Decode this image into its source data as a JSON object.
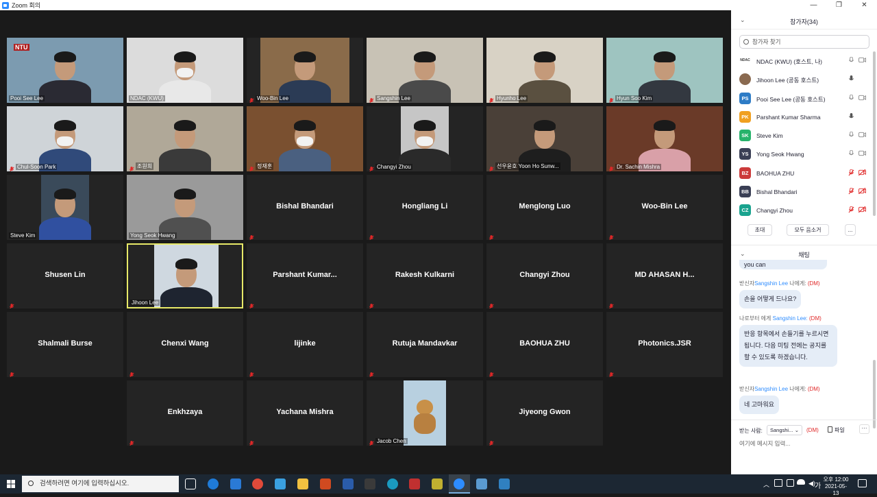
{
  "window": {
    "title": "Zoom 회의",
    "buttons": [
      "—",
      "❐",
      "✕"
    ]
  },
  "tiles": [
    {
      "label": "Pooi See Lee",
      "muted": false,
      "video": true
    },
    {
      "label": "NDAC (KWU)",
      "muted": false,
      "video": true
    },
    {
      "label": "Woo-Bin Lee",
      "muted": true,
      "video": true
    },
    {
      "label": "Sangshin Lee",
      "muted": true,
      "video": true
    },
    {
      "label": "Hyunho Lee",
      "muted": true,
      "video": true
    },
    {
      "label": "Hyun Soo Kim",
      "muted": true,
      "video": true
    },
    {
      "label": "Chul-Soon Park",
      "muted": true,
      "video": true
    },
    {
      "label": "조원희",
      "muted": true,
      "video": true
    },
    {
      "label": "정재훈",
      "muted": true,
      "video": true
    },
    {
      "label": "Changyi Zhou",
      "muted": true,
      "video": true
    },
    {
      "label": "선우윤호 Yoon Ho Sunw...",
      "muted": true,
      "video": true
    },
    {
      "label": "Dr. Sachin Mishra",
      "muted": true,
      "video": true
    },
    {
      "label": "Steve Kim",
      "muted": false,
      "video": true
    },
    {
      "label": "Yong Seok Hwang",
      "muted": false,
      "video": true
    },
    {
      "name": "Bishal Bhandari",
      "muted": true,
      "video": false
    },
    {
      "name": "Hongliang Li",
      "muted": true,
      "video": false
    },
    {
      "name": "Menglong Luo",
      "muted": true,
      "video": false
    },
    {
      "name": "Woo-Bin Lee",
      "muted": true,
      "video": false
    },
    {
      "name": "Shusen Lin",
      "muted": true,
      "video": false
    },
    {
      "label": "Jihoon Lee",
      "muted": false,
      "video": true,
      "active": true
    },
    {
      "name": "Parshant  Kumar...",
      "muted": true,
      "video": false
    },
    {
      "name": "Rakesh Kulkarni",
      "muted": true,
      "video": false
    },
    {
      "name": "Changyi Zhou",
      "muted": true,
      "video": false
    },
    {
      "name": "MD  AHASAN  H...",
      "muted": true,
      "video": false
    },
    {
      "name": "Shalmali Burse",
      "muted": true,
      "video": false
    },
    {
      "name": "Chenxi Wang",
      "muted": true,
      "video": false
    },
    {
      "name": "lijinke",
      "muted": true,
      "video": false
    },
    {
      "name": "Rutuja Mandavkar",
      "muted": true,
      "video": false
    },
    {
      "name": "BAOHUA ZHU",
      "muted": true,
      "video": false
    },
    {
      "name": "Photonics.JSR",
      "muted": true,
      "video": false
    },
    {
      "name": "Enkhzaya",
      "muted": true,
      "video": false
    },
    {
      "name": "Yachana Mishra",
      "muted": true,
      "video": false
    },
    {
      "label": "Jacob Chen",
      "muted": true,
      "video": true
    },
    {
      "name": "Jiyeong Gwon",
      "muted": true,
      "video": false
    }
  ],
  "participants": {
    "title": "참가자(34)",
    "search_placeholder": "참가자 찾기",
    "list": [
      {
        "name": "NDAC (KWU) (호스트, 나)",
        "avatar": "NDAC",
        "color": "#ffffff",
        "mic": "on",
        "cam": "on"
      },
      {
        "name": "Jihoon Lee (공동 호스트)",
        "avatar": "",
        "color": "#8a6a50",
        "mic": "on",
        "cam": "none"
      },
      {
        "name": "Pooi See Lee (공동 호스트)",
        "avatar": "PS",
        "color": "#2e7cc6",
        "mic": "on",
        "cam": "on"
      },
      {
        "name": "Parshant Kumar Sharma",
        "avatar": "PK",
        "color": "#f0a020",
        "mic": "on",
        "cam": "none"
      },
      {
        "name": "Steve Kim",
        "avatar": "SK",
        "color": "#27b36b",
        "mic": "on",
        "cam": "on"
      },
      {
        "name": "Yong Seok Hwang",
        "avatar": "YS",
        "color": "#3a3f55",
        "mic": "on",
        "cam": "on"
      },
      {
        "name": "BAOHUA ZHU",
        "avatar": "BZ",
        "color": "#cc3b3b",
        "mic": "off",
        "cam": "off"
      },
      {
        "name": "Bishal Bhandari",
        "avatar": "BB",
        "color": "#3a3f55",
        "mic": "off",
        "cam": "off"
      },
      {
        "name": "Changyi Zhou",
        "avatar": "CZ",
        "color": "#1aa38f",
        "mic": "off",
        "cam": "off"
      }
    ],
    "invite": "초대",
    "mute_all": "모두 음소거",
    "more": "..."
  },
  "chat": {
    "title": "채팅",
    "partial_msg": "you can",
    "messages": [
      {
        "from": "받신자",
        "who": "Sangshin Lee",
        "to": "나에게:",
        "dm": "(DM)",
        "text": "손을 어떻게 드나요?"
      },
      {
        "from": "나로부터 에게",
        "who": "Sangshin Lee:",
        "to": "",
        "dm": "(DM)",
        "text": "반응 항목에서 손들기를 누르시면 됩니다. 다음 미팅 전에는 공지를 할 수 있도록 하겠습니다."
      },
      {
        "from": "받신자",
        "who": "Sangshin Lee",
        "to": "나에게:",
        "dm": "(DM)",
        "text": "네 고마워요"
      }
    ],
    "recipient_label": "받는 사람:",
    "recipient": "Sangshi...",
    "dm": "(DM)",
    "file": "파일",
    "input_placeholder": "여기에 메시지 입력..."
  },
  "taskbar": {
    "search": "검색하려면 여기에 입력하십시오.",
    "ime": "가",
    "ampm": "오후 12:00",
    "date": "2021-05-13"
  }
}
